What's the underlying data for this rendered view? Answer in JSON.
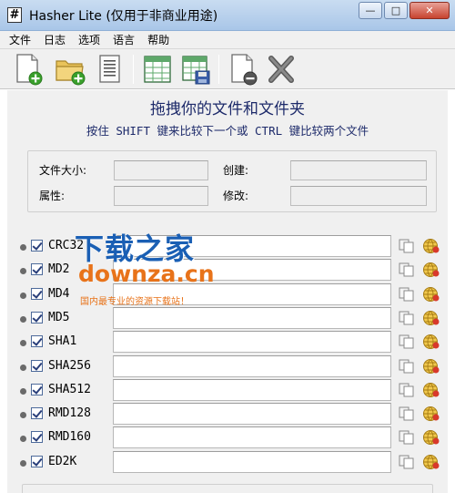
{
  "window": {
    "app_icon": "#",
    "title": "Hasher Lite (仅用于非商业用途)",
    "minimize": "—",
    "maximize": "□",
    "close": "✕"
  },
  "menu": [
    "文件",
    "日志",
    "选项",
    "语言",
    "帮助"
  ],
  "toolbar": {
    "icons": [
      "add-file-icon",
      "add-folder-icon",
      "text-document-icon",
      "table-icon",
      "table-save-icon",
      "remove-file-icon",
      "close-x-icon"
    ]
  },
  "main": {
    "heading": "拖拽你的文件和文件夹",
    "subheading": "按住 SHIFT 键来比较下一个或 CTRL 键比较两个文件"
  },
  "info": {
    "size_label": "文件大小:",
    "attr_label": "属性:",
    "created_label": "创建:",
    "modified_label": "修改:"
  },
  "hashes": [
    {
      "name": "CRC32",
      "checked": true,
      "value": ""
    },
    {
      "name": "MD2",
      "checked": true,
      "value": ""
    },
    {
      "name": "MD4",
      "checked": true,
      "value": ""
    },
    {
      "name": "MD5",
      "checked": true,
      "value": ""
    },
    {
      "name": "SHA1",
      "checked": true,
      "value": ""
    },
    {
      "name": "SHA256",
      "checked": true,
      "value": ""
    },
    {
      "name": "SHA512",
      "checked": true,
      "value": ""
    },
    {
      "name": "RMD128",
      "checked": true,
      "value": ""
    },
    {
      "name": "RMD160",
      "checked": true,
      "value": ""
    },
    {
      "name": "ED2K",
      "checked": true,
      "value": ""
    }
  ],
  "watermark": {
    "line1": "下载之家",
    "line2": "downza.cn",
    "line3": "国内最专业的资源下载站！"
  },
  "colors": {
    "heading": "#1d2a6a",
    "watermark_blue": "#1a5fb4",
    "watermark_orange": "#e8731a"
  }
}
